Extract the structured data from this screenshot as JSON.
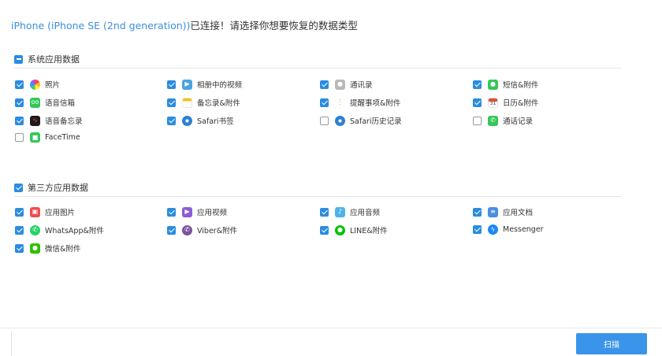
{
  "header": {
    "device_name": "iPhone (iPhone SE (2nd generation))",
    "prompt": "已连接！请选择你想要恢复的数据类型"
  },
  "system_section": {
    "label": "系统应用数据",
    "state": "partial",
    "items": [
      {
        "label": "照片",
        "checked": true,
        "icon": "photos-icon",
        "color": "#ffffff"
      },
      {
        "label": "相册中的视频",
        "checked": true,
        "icon": "video-album-icon",
        "color": "#4aa3df"
      },
      {
        "label": "通讯录",
        "checked": true,
        "icon": "contacts-icon",
        "color": "#9e9e9e"
      },
      {
        "label": "短信&附件",
        "checked": true,
        "icon": "messages-icon",
        "color": "#34c759"
      },
      {
        "label": "语音信箱",
        "checked": true,
        "icon": "voicemail-icon",
        "color": "#34c759"
      },
      {
        "label": "备忘录&附件",
        "checked": true,
        "icon": "notes-icon",
        "color": "#f5c518"
      },
      {
        "label": "提醒事项&附件",
        "checked": true,
        "icon": "reminders-icon",
        "color": "#ffffff"
      },
      {
        "label": "日历&附件",
        "checked": true,
        "icon": "calendar-icon",
        "color": "#ffffff"
      },
      {
        "label": "语音备忘录",
        "checked": true,
        "icon": "voice-memos-icon",
        "color": "#222222"
      },
      {
        "label": "Safari书签",
        "checked": true,
        "icon": "safari-icon",
        "color": "#2d7fd3"
      },
      {
        "label": "Safari历史记录",
        "checked": false,
        "icon": "safari-icon",
        "color": "#2d7fd3"
      },
      {
        "label": "通话记录",
        "checked": false,
        "icon": "phone-icon",
        "color": "#34c759"
      },
      {
        "label": "FaceTime",
        "checked": false,
        "icon": "facetime-icon",
        "color": "#34c759"
      }
    ]
  },
  "third_party_section": {
    "label": "第三方应用数据",
    "state": "checked",
    "items": [
      {
        "label": "应用图片",
        "checked": true,
        "icon": "app-photos-icon",
        "color": "#ef4b4b"
      },
      {
        "label": "应用视频",
        "checked": true,
        "icon": "app-video-icon",
        "color": "#8e5bd8"
      },
      {
        "label": "应用音频",
        "checked": true,
        "icon": "app-audio-icon",
        "color": "#4fb3e8"
      },
      {
        "label": "应用文档",
        "checked": true,
        "icon": "app-documents-icon",
        "color": "#4a8fe0"
      },
      {
        "label": "WhatsApp&附件",
        "checked": true,
        "icon": "whatsapp-icon",
        "color": "#25d366"
      },
      {
        "label": "Viber&附件",
        "checked": true,
        "icon": "viber-icon",
        "color": "#7b519d"
      },
      {
        "label": "LINE&附件",
        "checked": true,
        "icon": "line-icon",
        "color": "#00c300"
      },
      {
        "label": "Messenger",
        "checked": true,
        "icon": "messenger-icon",
        "color": "#1e88f5"
      },
      {
        "label": "微信&附件",
        "checked": true,
        "icon": "wechat-icon",
        "color": "#2dc100"
      }
    ]
  },
  "footer": {
    "scan_label": "扫描"
  }
}
